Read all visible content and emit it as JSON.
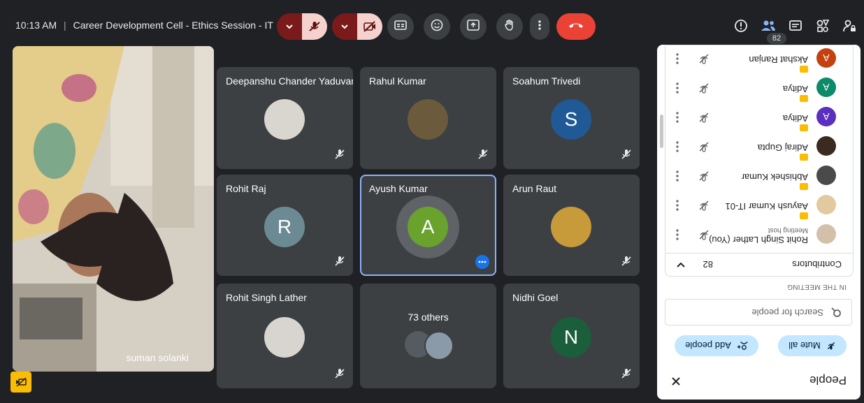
{
  "header": {
    "time": "10:13 AM",
    "separator": "|",
    "meeting_title": "Career Development Cell - Ethics Session - IT",
    "people_count": "82"
  },
  "self_view": {
    "name": "suman solanki"
  },
  "tiles": [
    {
      "name": "Nidhi Goel",
      "initial": "N",
      "color": "#1b5e3b"
    },
    {
      "name": "73 others"
    },
    {
      "name": "Rohit Singh Lather"
    },
    {
      "name": "Arun Raut"
    },
    {
      "name": "Ayush Kumar",
      "initial": "A",
      "color": "#6aa22e"
    },
    {
      "name": "Rohit Raj",
      "initial": "R",
      "color": "#6c8a94"
    },
    {
      "name": "Soahum Trivedi",
      "initial": "S",
      "color": "#1f5a96"
    },
    {
      "name": "Rahul Kumar"
    },
    {
      "name": "Deepanshu Chander Yaduvan..."
    }
  ],
  "panel": {
    "title": "People",
    "mute_all": "Mute all",
    "add_people": "Add people",
    "search_placeholder": "Search for people",
    "section_label": "IN THE MEETING",
    "contributors_label": "Contributors",
    "contributors_count": "82",
    "participants": [
      {
        "name": "Rohit Singh Lather (You)",
        "sub": "Meeting host"
      },
      {
        "name": "Aayush Kumar IT-01"
      },
      {
        "name": "Abhishek Kumar"
      },
      {
        "name": "Adiraj Gupta"
      },
      {
        "name": "Aditya",
        "initial": "A",
        "color": "#5b2fbf"
      },
      {
        "name": "Aditya",
        "initial": "A",
        "color": "#0d8a6a"
      },
      {
        "name": "Akshat Ranjan",
        "initial": "A",
        "color": "#c4410f"
      }
    ]
  },
  "colors": {
    "background": "#202124",
    "tile": "#3c4043",
    "end_call": "#ea4335",
    "accent": "#1a73e8"
  }
}
